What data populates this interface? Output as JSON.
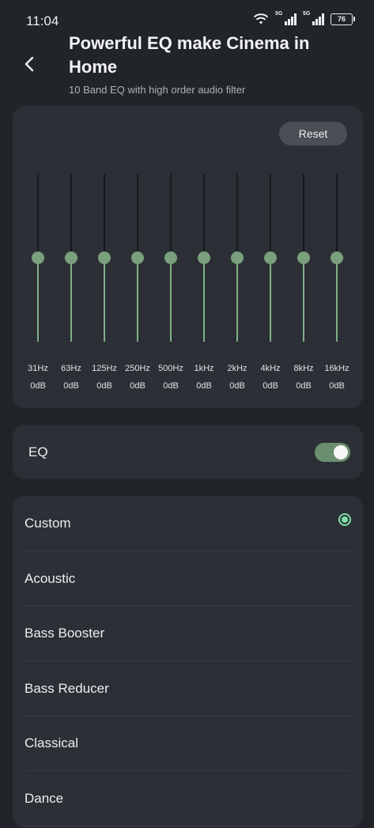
{
  "status_bar": {
    "time": "11:04",
    "signal_1_tag": "5G",
    "signal_2_tag": "5G",
    "battery": "76"
  },
  "header": {
    "title": "Powerful EQ make Cinema in Home",
    "subtitle": "10 Band EQ with high order audio filter"
  },
  "equalizer": {
    "reset_label": "Reset",
    "bands": [
      {
        "freq": "31Hz",
        "gain": "0dB",
        "level": 0.5
      },
      {
        "freq": "63Hz",
        "gain": "0dB",
        "level": 0.5
      },
      {
        "freq": "125Hz",
        "gain": "0dB",
        "level": 0.5
      },
      {
        "freq": "250Hz",
        "gain": "0dB",
        "level": 0.5
      },
      {
        "freq": "500Hz",
        "gain": "0dB",
        "level": 0.5
      },
      {
        "freq": "1kHz",
        "gain": "0dB",
        "level": 0.5
      },
      {
        "freq": "2kHz",
        "gain": "0dB",
        "level": 0.5
      },
      {
        "freq": "4kHz",
        "gain": "0dB",
        "level": 0.5
      },
      {
        "freq": "8kHz",
        "gain": "0dB",
        "level": 0.5
      },
      {
        "freq": "16kHz",
        "gain": "0dB",
        "level": 0.5
      }
    ]
  },
  "eq_toggle": {
    "label": "EQ",
    "on": true
  },
  "presets": {
    "selected": "Custom",
    "items": [
      "Custom",
      "Acoustic",
      "Bass Booster",
      "Bass Reducer",
      "Classical",
      "Dance"
    ]
  },
  "colors": {
    "accent": "#7ce0a6",
    "slider_fill": "#7fb185",
    "toggle_on": "#6b8e6e"
  }
}
